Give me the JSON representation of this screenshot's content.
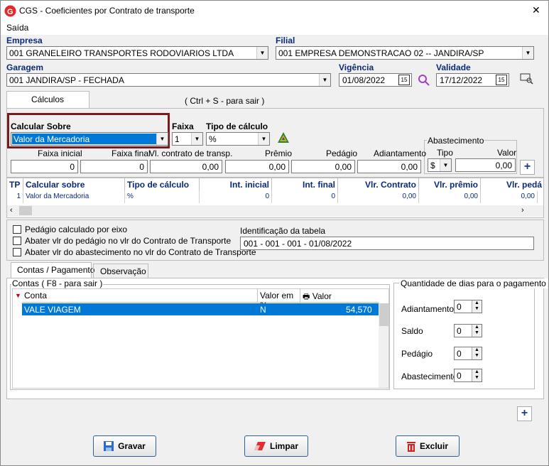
{
  "window": {
    "title": "CGS - Coeficientes por Contrato de transporte",
    "close": "✕"
  },
  "menu": {
    "saida": "Saída"
  },
  "empresa": {
    "label": "Empresa",
    "value": "001 GRANELEIRO TRANSPORTES RODOVIARIOS LTDA"
  },
  "filial": {
    "label": "Filial",
    "value": "001 EMPRESA DEMONSTRACAO 02 -- JANDIRA/SP"
  },
  "garagem": {
    "label": "Garagem",
    "value": "001 JANDIRA/SP - FECHADA"
  },
  "vigencia": {
    "label": "Vigência",
    "value": "01/08/2022"
  },
  "validade": {
    "label": "Validade",
    "value": "17/12/2022"
  },
  "tabs_top": {
    "calculos": "Cálculos",
    "hint": "( Ctrl + S - para sair )"
  },
  "calc": {
    "calcular_sobre_label": "Calcular Sobre",
    "calcular_sobre_value": "Valor da Mercadoria",
    "faixa_label": "Faixa",
    "faixa_value": "1",
    "tipo_label": "Tipo de cálculo",
    "tipo_value": "%",
    "abastecimento_label": "Abastecimento",
    "ab_tipo_label": "Tipo",
    "ab_tipo_value": "$",
    "ab_valor_label": "Valor",
    "ab_valor_value": "0,00",
    "faixa_inicial_label": "Faixa inicial",
    "faixa_inicial_value": "0",
    "faixa_final_label": "Faixa final",
    "faixa_final_value": "0",
    "vlr_contrato_label": "Vl. contrato de transp.",
    "vlr_contrato_value": "0,00",
    "premio_label": "Prêmio",
    "premio_value": "0,00",
    "pedagio_label": "Pedágio",
    "pedagio_value": "0,00",
    "adiantamento_label": "Adiantamento",
    "adiantamento_value": "0,00"
  },
  "grid": {
    "headers": [
      "TP",
      "Calcular sobre",
      "Tipo de cálculo",
      "Int. inicial",
      "Int. final",
      "Vlr. Contrato",
      "Vlr. prêmio",
      "Vlr. pedá"
    ],
    "row": [
      "1",
      "Valor da Mercadoria",
      "%",
      "0",
      "0",
      "0,00",
      "0,00",
      "0,00"
    ]
  },
  "options": {
    "pedagio_eixo": "Pedágio calculado por eixo",
    "abater_pedagio": "Abater vlr do pedágio no vlr do Contrato de Transporte",
    "abater_abastecimento": "Abater vlr do abastecimento no vlr do Contrato de Transporte",
    "identificacao_label": "Identificação da tabela",
    "identificacao_value": "001 - 001 - 001 - 01/08/2022"
  },
  "tabs_bottom": {
    "contas": "Contas / Pagamento",
    "observacao": "Observação"
  },
  "contas": {
    "group_label": "Contas ( F8 - para sair )",
    "headers": [
      "Conta",
      "Valor em %",
      "Valor"
    ],
    "row": [
      "VALE VIAGEM",
      "N",
      "54,570"
    ]
  },
  "dias": {
    "group_label": "Quantidade de dias para o pagamento",
    "adiantamento_label": "Adiantamento",
    "adiantamento_value": "0",
    "saldo_label": "Saldo",
    "saldo_value": "0",
    "pedagio_label": "Pedágio",
    "pedagio_value": "0",
    "abastecimento_label": "Abastecimento",
    "abastecimento_value": "0"
  },
  "buttons": {
    "gravar": "Gravar",
    "limpar": "Limpar",
    "excluir": "Excluir"
  },
  "colors": {
    "accent": "#0a2a7a",
    "selection": "#0078d7",
    "highlight_border": "#7a1a1a",
    "logo": "#e02a2a"
  }
}
